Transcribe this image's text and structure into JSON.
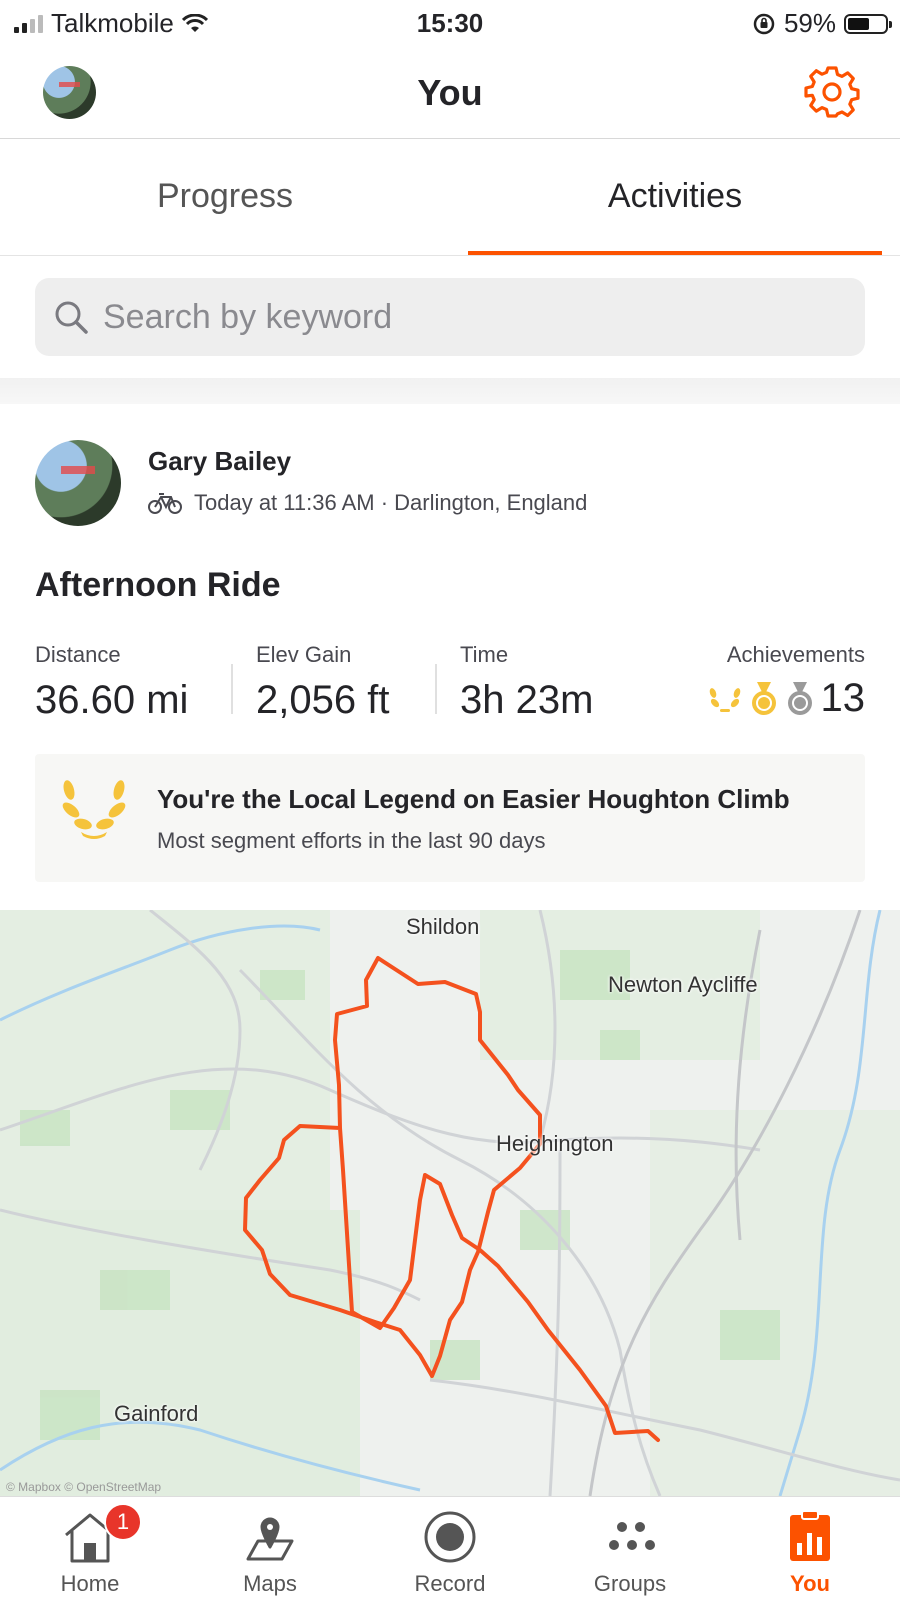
{
  "status_bar": {
    "carrier": "Talkmobile",
    "time": "15:30",
    "battery": "59%",
    "battery_level": 0.59
  },
  "header": {
    "title": "You"
  },
  "tabs": [
    {
      "label": "Progress",
      "active": false
    },
    {
      "label": "Activities",
      "active": true
    }
  ],
  "search": {
    "placeholder": "Search by keyword",
    "value": ""
  },
  "activity": {
    "athlete": "Gary Bailey",
    "meta": "Today at 11:36 AM · Darlington, England",
    "title": "Afternoon Ride",
    "stats": [
      {
        "label": "Distance",
        "value": "36.60 mi"
      },
      {
        "label": "Elev Gain",
        "value": "2,056 ft"
      },
      {
        "label": "Time",
        "value": "3h 23m"
      }
    ],
    "achievements": {
      "label": "Achievements",
      "count": "13"
    },
    "legend": {
      "title": "You're the Local Legend on Easier Houghton Climb",
      "subtitle": "Most segment efforts in the last 90 days"
    },
    "map": {
      "labels": {
        "shildon": "Shildon",
        "newton": "Newton Aycliffe",
        "heighington": "Heighington",
        "gainford": "Gainford"
      },
      "attribution": "© Mapbox © OpenStreetMap"
    }
  },
  "nav": {
    "home": {
      "label": "Home",
      "badge": "1"
    },
    "maps": {
      "label": "Maps"
    },
    "record": {
      "label": "Record"
    },
    "groups": {
      "label": "Groups"
    },
    "you": {
      "label": "You"
    }
  },
  "colors": {
    "accent": "#fc5200",
    "route": "#f4511e",
    "badge": "#e8352a"
  }
}
